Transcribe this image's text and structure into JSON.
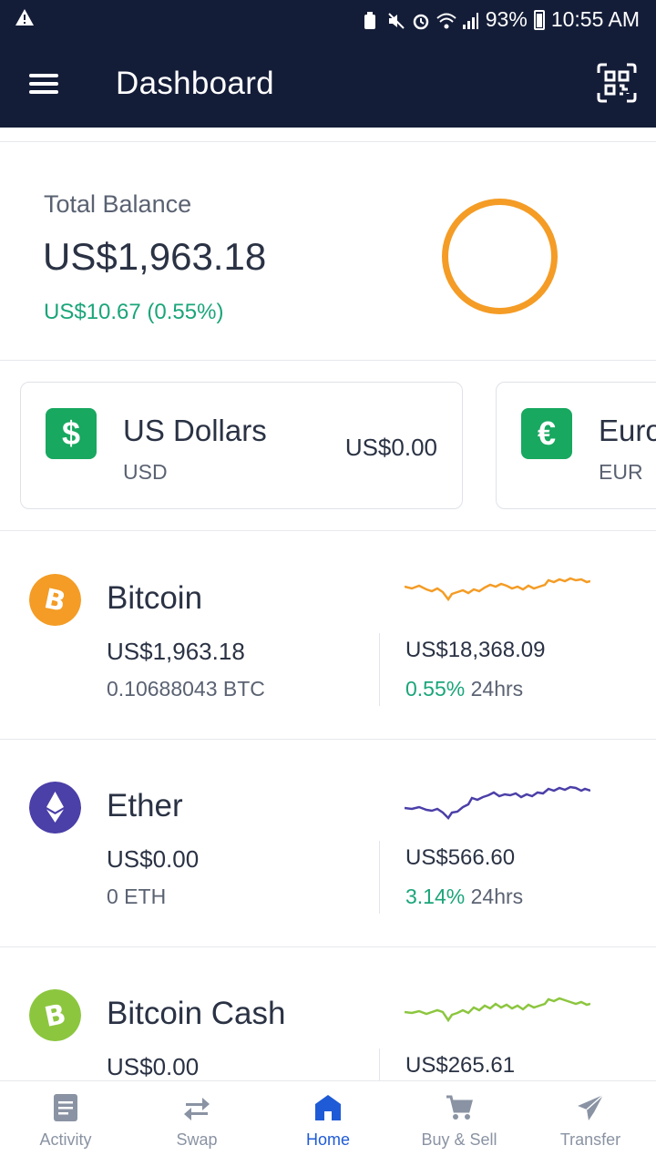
{
  "status_bar": {
    "battery": "93%",
    "time": "10:55 AM"
  },
  "app_bar": {
    "title": "Dashboard"
  },
  "balance": {
    "label": "Total Balance",
    "value": "US$1,963.18",
    "change": "US$10.67 (0.55%)",
    "ring_color": "#f49c25"
  },
  "fiat_accounts": [
    {
      "symbol": "$",
      "name": "US Dollars",
      "code": "USD",
      "amount": "US$0.00"
    },
    {
      "symbol": "€",
      "name": "Euro",
      "code": "EUR"
    }
  ],
  "crypto_assets": [
    {
      "name": "Bitcoin",
      "value": "US$1,963.18",
      "amount": "0.10688043 BTC",
      "price": "US$18,368.09",
      "change_pct": "0.55%",
      "change_period": "24hrs",
      "color": "#f49c25",
      "icon": "bitcoin-icon"
    },
    {
      "name": "Ether",
      "value": "US$0.00",
      "amount": "0 ETH",
      "price": "US$566.60",
      "change_pct": "3.14%",
      "change_period": "24hrs",
      "color": "#4b3fa8",
      "icon": "ether-icon"
    },
    {
      "name": "Bitcoin Cash",
      "value": "US$0.00",
      "price": "US$265.61",
      "color": "#8cc63f",
      "icon": "bitcoin-cash-icon"
    }
  ],
  "bottom_nav": [
    {
      "label": "Activity",
      "icon": "activity-icon"
    },
    {
      "label": "Swap",
      "icon": "swap-icon"
    },
    {
      "label": "Home",
      "icon": "home-icon",
      "active": true
    },
    {
      "label": "Buy & Sell",
      "icon": "cart-icon"
    },
    {
      "label": "Transfer",
      "icon": "send-icon"
    }
  ],
  "colors": {
    "header": "#141d38",
    "positive": "#1ba57a",
    "accent": "#1f5bd6",
    "fiat_green": "#18a860"
  }
}
